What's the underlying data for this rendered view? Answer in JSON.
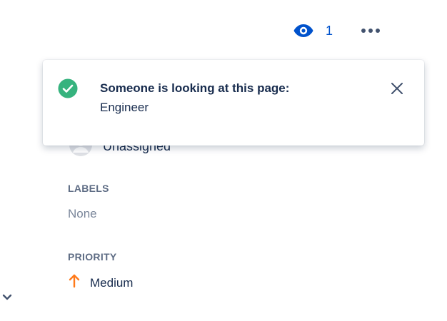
{
  "toolbar": {
    "watch_icon": "eye-icon",
    "watch_count": "1",
    "more_icon": "more-horizontal-icon",
    "accent_color": "#0052cc"
  },
  "flag": {
    "status_icon": "check-circle-icon",
    "status_color": "#36b37e",
    "title": "Someone is looking at this page:",
    "body": "Engineer",
    "close_icon": "close-icon"
  },
  "details": {
    "assignee": {
      "avatar_icon": "user-avatar-icon",
      "value": "Unassigned"
    },
    "labels": {
      "title": "LABELS",
      "value": "None"
    },
    "priority": {
      "title": "PRIORITY",
      "icon": "arrow-up-icon",
      "icon_color": "#ff7a1a",
      "value": "Medium"
    }
  },
  "collapse_icon": "chevron-down-icon"
}
